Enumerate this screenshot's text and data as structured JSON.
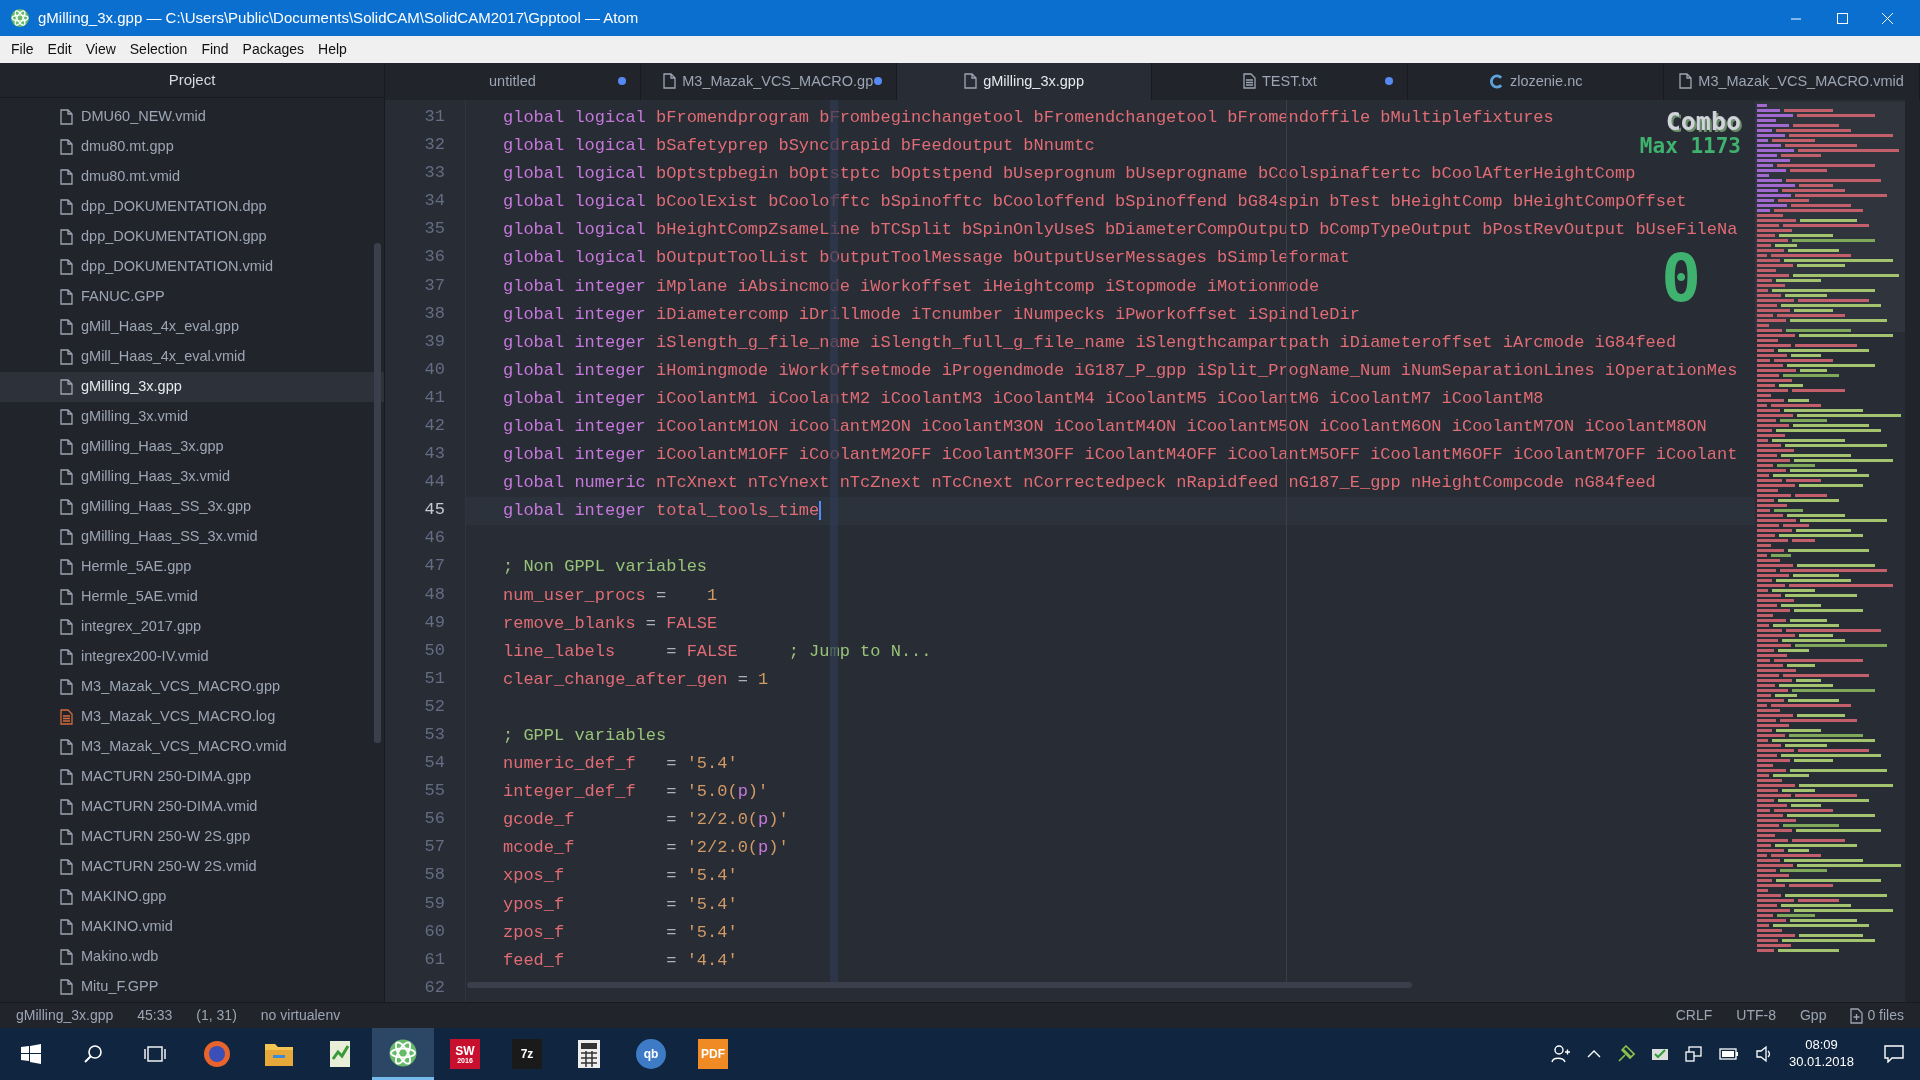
{
  "window": {
    "title": "gMilling_3x.gpp — C:\\Users\\Public\\Documents\\SolidCAM\\SolidCAM2017\\Gpptool — Atom"
  },
  "menu": [
    "File",
    "Edit",
    "View",
    "Selection",
    "Find",
    "Packages",
    "Help"
  ],
  "project": {
    "title": "Project",
    "items": [
      {
        "label": "DMU60_NEW.vmid",
        "kind": "file",
        "selected": false
      },
      {
        "label": "dmu80.mt.gpp",
        "kind": "file",
        "selected": false
      },
      {
        "label": "dmu80.mt.vmid",
        "kind": "file",
        "selected": false
      },
      {
        "label": "dpp_DOKUMENTATION.dpp",
        "kind": "file",
        "selected": false
      },
      {
        "label": "dpp_DOKUMENTATION.gpp",
        "kind": "file",
        "selected": false
      },
      {
        "label": "dpp_DOKUMENTATION.vmid",
        "kind": "file",
        "selected": false
      },
      {
        "label": "FANUC.GPP",
        "kind": "file",
        "selected": false
      },
      {
        "label": "gMill_Haas_4x_eval.gpp",
        "kind": "file",
        "selected": false
      },
      {
        "label": "gMill_Haas_4x_eval.vmid",
        "kind": "file",
        "selected": false
      },
      {
        "label": "gMilling_3x.gpp",
        "kind": "file",
        "selected": true
      },
      {
        "label": "gMilling_3x.vmid",
        "kind": "file",
        "selected": false
      },
      {
        "label": "gMilling_Haas_3x.gpp",
        "kind": "file",
        "selected": false
      },
      {
        "label": "gMilling_Haas_3x.vmid",
        "kind": "file",
        "selected": false
      },
      {
        "label": "gMilling_Haas_SS_3x.gpp",
        "kind": "file",
        "selected": false
      },
      {
        "label": "gMilling_Haas_SS_3x.vmid",
        "kind": "file",
        "selected": false
      },
      {
        "label": "Hermle_5AE.gpp",
        "kind": "file",
        "selected": false
      },
      {
        "label": "Hermle_5AE.vmid",
        "kind": "file",
        "selected": false
      },
      {
        "label": "integrex_2017.gpp",
        "kind": "file",
        "selected": false
      },
      {
        "label": "integrex200-IV.vmid",
        "kind": "file",
        "selected": false
      },
      {
        "label": "M3_Mazak_VCS_MACRO.gpp",
        "kind": "file",
        "selected": false
      },
      {
        "label": "M3_Mazak_VCS_MACRO.log",
        "kind": "log",
        "selected": false
      },
      {
        "label": "M3_Mazak_VCS_MACRO.vmid",
        "kind": "file",
        "selected": false
      },
      {
        "label": "MACTURN 250-DIMA.gpp",
        "kind": "file",
        "selected": false
      },
      {
        "label": "MACTURN 250-DIMA.vmid",
        "kind": "file",
        "selected": false
      },
      {
        "label": "MACTURN 250-W 2S.gpp",
        "kind": "file",
        "selected": false
      },
      {
        "label": "MACTURN 250-W 2S.vmid",
        "kind": "file",
        "selected": false
      },
      {
        "label": "MAKINO.gpp",
        "kind": "file",
        "selected": false
      },
      {
        "label": "MAKINO.vmid",
        "kind": "file",
        "selected": false
      },
      {
        "label": "Makino.wdb",
        "kind": "file",
        "selected": false
      },
      {
        "label": "Mitu_F.GPP",
        "kind": "file",
        "selected": false
      }
    ]
  },
  "tabs": [
    {
      "label": "untitled",
      "kind": "plain",
      "modified": true,
      "selected": false
    },
    {
      "label": "M3_Mazak_VCS_MACRO.gp",
      "kind": "file",
      "modified": true,
      "selected": false
    },
    {
      "label": "gMilling_3x.gpp",
      "kind": "file",
      "modified": false,
      "selected": true
    },
    {
      "label": "TEST.txt",
      "kind": "text",
      "modified": true,
      "selected": false
    },
    {
      "label": "zlozenie.nc",
      "kind": "nc",
      "modified": false,
      "selected": false
    },
    {
      "label": "M3_Mazak_VCS_MACRO.vmid",
      "kind": "file",
      "modified": false,
      "selected": false
    }
  ],
  "code": {
    "lines": [
      {
        "number": "31",
        "current": false,
        "tokens": [
          {
            "kind": "keyword",
            "text": "global logical "
          },
          {
            "kind": "name",
            "text": "bFromendprogram bFrombeginchangetool bFromendchangetool bFromendoffile bMultiplefixtures"
          }
        ]
      },
      {
        "number": "32",
        "current": false,
        "tokens": [
          {
            "kind": "keyword",
            "text": "global logical "
          },
          {
            "kind": "name",
            "text": "bSafetyprep bSyncdrapid bFeedoutput bNnumtc"
          }
        ]
      },
      {
        "number": "33",
        "current": false,
        "tokens": [
          {
            "kind": "keyword",
            "text": "global logical "
          },
          {
            "kind": "name",
            "text": "bOptstpbegin bOptstptc bOptstpend bUseprognum bUseprogname bCoolspinaftertc bCoolAfterHeightComp"
          }
        ]
      },
      {
        "number": "34",
        "current": false,
        "tokens": [
          {
            "kind": "keyword",
            "text": "global logical "
          },
          {
            "kind": "name",
            "text": "bCoolExist bCoolofftc bSpinofftc bCooloffend bSpinoffend bG84spin bTest bHeightComp bHeightCompOffset"
          }
        ]
      },
      {
        "number": "35",
        "current": false,
        "tokens": [
          {
            "kind": "keyword",
            "text": "global logical "
          },
          {
            "kind": "name",
            "text": "bHeightCompZsameLine bTCSplit bSpinOnlyUseS bDiameterCompOutputD bCompTypeOutput bPostRevOutput bUseFileNa"
          }
        ]
      },
      {
        "number": "36",
        "current": false,
        "tokens": [
          {
            "kind": "keyword",
            "text": "global logical "
          },
          {
            "kind": "name",
            "text": "bOutputToolList bOutputToolMessage bOutputUserMessages bSimpleformat"
          }
        ]
      },
      {
        "number": "37",
        "current": false,
        "tokens": [
          {
            "kind": "keyword",
            "text": "global integer "
          },
          {
            "kind": "name",
            "text": "iMplane iAbsincmode iWorkoffset iHeightcomp iStopmode iMotionmode"
          }
        ]
      },
      {
        "number": "38",
        "current": false,
        "tokens": [
          {
            "kind": "keyword",
            "text": "global integer "
          },
          {
            "kind": "name",
            "text": "iDiametercomp iDrillmode iTcnumber iNumpecks iPworkoffset iSpindleDir"
          }
        ]
      },
      {
        "number": "39",
        "current": false,
        "tokens": [
          {
            "kind": "keyword",
            "text": "global integer "
          },
          {
            "kind": "name",
            "text": "iSlength_g_file_name iSlength_full_g_file_name iSlengthcampartpath iDiameteroffset iArcmode iG84feed"
          }
        ]
      },
      {
        "number": "40",
        "current": false,
        "tokens": [
          {
            "kind": "keyword",
            "text": "global integer "
          },
          {
            "kind": "name",
            "text": "iHomingmode iWorkOffsetmode iProgendmode iG187_P_gpp iSplit_ProgName_Num iNumSeparationLines iOperationMes"
          }
        ]
      },
      {
        "number": "41",
        "current": false,
        "tokens": [
          {
            "kind": "keyword",
            "text": "global integer "
          },
          {
            "kind": "name",
            "text": "iCoolantM1 iCoolantM2 iCoolantM3 iCoolantM4 iCoolantM5 iCoolantM6 iCoolantM7 iCoolantM8"
          }
        ]
      },
      {
        "number": "42",
        "current": false,
        "tokens": [
          {
            "kind": "keyword",
            "text": "global integer "
          },
          {
            "kind": "name",
            "text": "iCoolantM1ON iCoolantM2ON iCoolantM3ON iCoolantM4ON iCoolantM5ON iCoolantM6ON iCoolantM7ON iCoolantM8ON"
          }
        ]
      },
      {
        "number": "43",
        "current": false,
        "tokens": [
          {
            "kind": "keyword",
            "text": "global integer "
          },
          {
            "kind": "name",
            "text": "iCoolantM1OFF iCoolantM2OFF iCoolantM3OFF iCoolantM4OFF iCoolantM5OFF iCoolantM6OFF iCoolantM7OFF iCoolant"
          }
        ]
      },
      {
        "number": "44",
        "current": false,
        "tokens": [
          {
            "kind": "keyword",
            "text": "global numeric "
          },
          {
            "kind": "name",
            "text": "nTcXnext nTcYnext nTcZnext nTcCnext nCorrectedpeck nRapidfeed nG187_E_gpp nHeightCompcode nG84feed"
          }
        ]
      },
      {
        "number": "45",
        "current": true,
        "tokens": [
          {
            "kind": "keyword",
            "text": "global integer "
          },
          {
            "kind": "name",
            "text": "total_tools_time"
          }
        ]
      },
      {
        "number": "46",
        "current": false
      },
      {
        "number": "47",
        "current": false,
        "tokens": [
          {
            "kind": "comment",
            "text": "; Non GPPL variables"
          }
        ]
      },
      {
        "number": "48",
        "current": false,
        "tokens": [
          {
            "kind": "name",
            "text": "num_user_procs"
          },
          {
            "kind": "operator",
            "text": " =    "
          },
          {
            "kind": "number",
            "text": "1"
          }
        ]
      },
      {
        "number": "49",
        "current": false,
        "tokens": [
          {
            "kind": "name",
            "text": "remove_blanks"
          },
          {
            "kind": "operator",
            "text": " = "
          },
          {
            "kind": "name",
            "text": "FALSE"
          }
        ]
      },
      {
        "number": "50",
        "current": false,
        "tokens": [
          {
            "kind": "name",
            "text": "line_labels"
          },
          {
            "kind": "operator",
            "text": "     = "
          },
          {
            "kind": "name",
            "text": "FALSE"
          },
          {
            "kind": "comment",
            "text": "     ; Jump to N..."
          }
        ]
      },
      {
        "number": "51",
        "current": false,
        "tokens": [
          {
            "kind": "name",
            "text": "clear_change_after_gen"
          },
          {
            "kind": "operator",
            "text": " = "
          },
          {
            "kind": "number",
            "text": "1"
          }
        ]
      },
      {
        "number": "52",
        "current": false
      },
      {
        "number": "53",
        "current": false,
        "tokens": [
          {
            "kind": "comment",
            "text": "; GPPL variables"
          }
        ]
      },
      {
        "number": "54",
        "current": false,
        "tokens": [
          {
            "kind": "name",
            "text": "numeric_def_f"
          },
          {
            "kind": "operator",
            "text": "   = "
          },
          {
            "kind": "string",
            "text": "'5.4'"
          }
        ]
      },
      {
        "number": "55",
        "current": false,
        "tokens": [
          {
            "kind": "name",
            "text": "integer_def_f"
          },
          {
            "kind": "operator",
            "text": "   = "
          },
          {
            "kind": "string",
            "text": "'5.0("
          },
          {
            "kind": "keyword",
            "text": "p"
          },
          {
            "kind": "string",
            "text": ")'"
          }
        ]
      },
      {
        "number": "56",
        "current": false,
        "tokens": [
          {
            "kind": "name",
            "text": "gcode_f"
          },
          {
            "kind": "operator",
            "text": "         = "
          },
          {
            "kind": "string",
            "text": "'2/2.0("
          },
          {
            "kind": "keyword",
            "text": "p"
          },
          {
            "kind": "string",
            "text": ")'"
          }
        ]
      },
      {
        "number": "57",
        "current": false,
        "tokens": [
          {
            "kind": "name",
            "text": "mcode_f"
          },
          {
            "kind": "operator",
            "text": "         = "
          },
          {
            "kind": "string",
            "text": "'2/2.0("
          },
          {
            "kind": "keyword",
            "text": "p"
          },
          {
            "kind": "string",
            "text": ")'"
          }
        ]
      },
      {
        "number": "58",
        "current": false,
        "tokens": [
          {
            "kind": "name",
            "text": "xpos_f"
          },
          {
            "kind": "operator",
            "text": "          = "
          },
          {
            "kind": "string",
            "text": "'5.4'"
          }
        ]
      },
      {
        "number": "59",
        "current": false,
        "tokens": [
          {
            "kind": "name",
            "text": "ypos_f"
          },
          {
            "kind": "operator",
            "text": "          = "
          },
          {
            "kind": "string",
            "text": "'5.4'"
          }
        ]
      },
      {
        "number": "60",
        "current": false,
        "tokens": [
          {
            "kind": "name",
            "text": "zpos_f"
          },
          {
            "kind": "operator",
            "text": "          = "
          },
          {
            "kind": "string",
            "text": "'5.4'"
          }
        ]
      },
      {
        "number": "61",
        "current": false,
        "tokens": [
          {
            "kind": "name",
            "text": "feed_f"
          },
          {
            "kind": "operator",
            "text": "          = "
          },
          {
            "kind": "string",
            "text": "'4.4'"
          }
        ]
      },
      {
        "number": "62",
        "current": false
      }
    ]
  },
  "combo": {
    "label": "Combo",
    "max": "Max 1173",
    "count": "0"
  },
  "status_bar": {
    "left": [
      "gMilling_3x.gpp",
      "45:33",
      "(1, 31)",
      "no virtualenv"
    ],
    "right": [
      "CRLF",
      "UTF-8",
      "Gpp"
    ],
    "files": "0 files"
  },
  "taskbar": {
    "apps": [
      {
        "kind": "globe",
        "active": false
      },
      {
        "kind": "folder",
        "active": false
      },
      {
        "kind": "document",
        "active": false
      },
      {
        "kind": "atom",
        "active": true
      },
      {
        "kind": "tile",
        "label": "SW",
        "sublabel": "2016",
        "color": "#c8102e",
        "active": false
      },
      {
        "kind": "tile",
        "label": "7z",
        "color": "#1a1a1a",
        "active": false
      },
      {
        "kind": "calculator",
        "active": false
      },
      {
        "kind": "round",
        "label": "qb",
        "color": "#3d7bc6",
        "active": false
      },
      {
        "kind": "tile",
        "label": "PDF",
        "color": "#f08a24",
        "active": false
      }
    ],
    "time": "08:09",
    "date": "30.01.2018"
  }
}
